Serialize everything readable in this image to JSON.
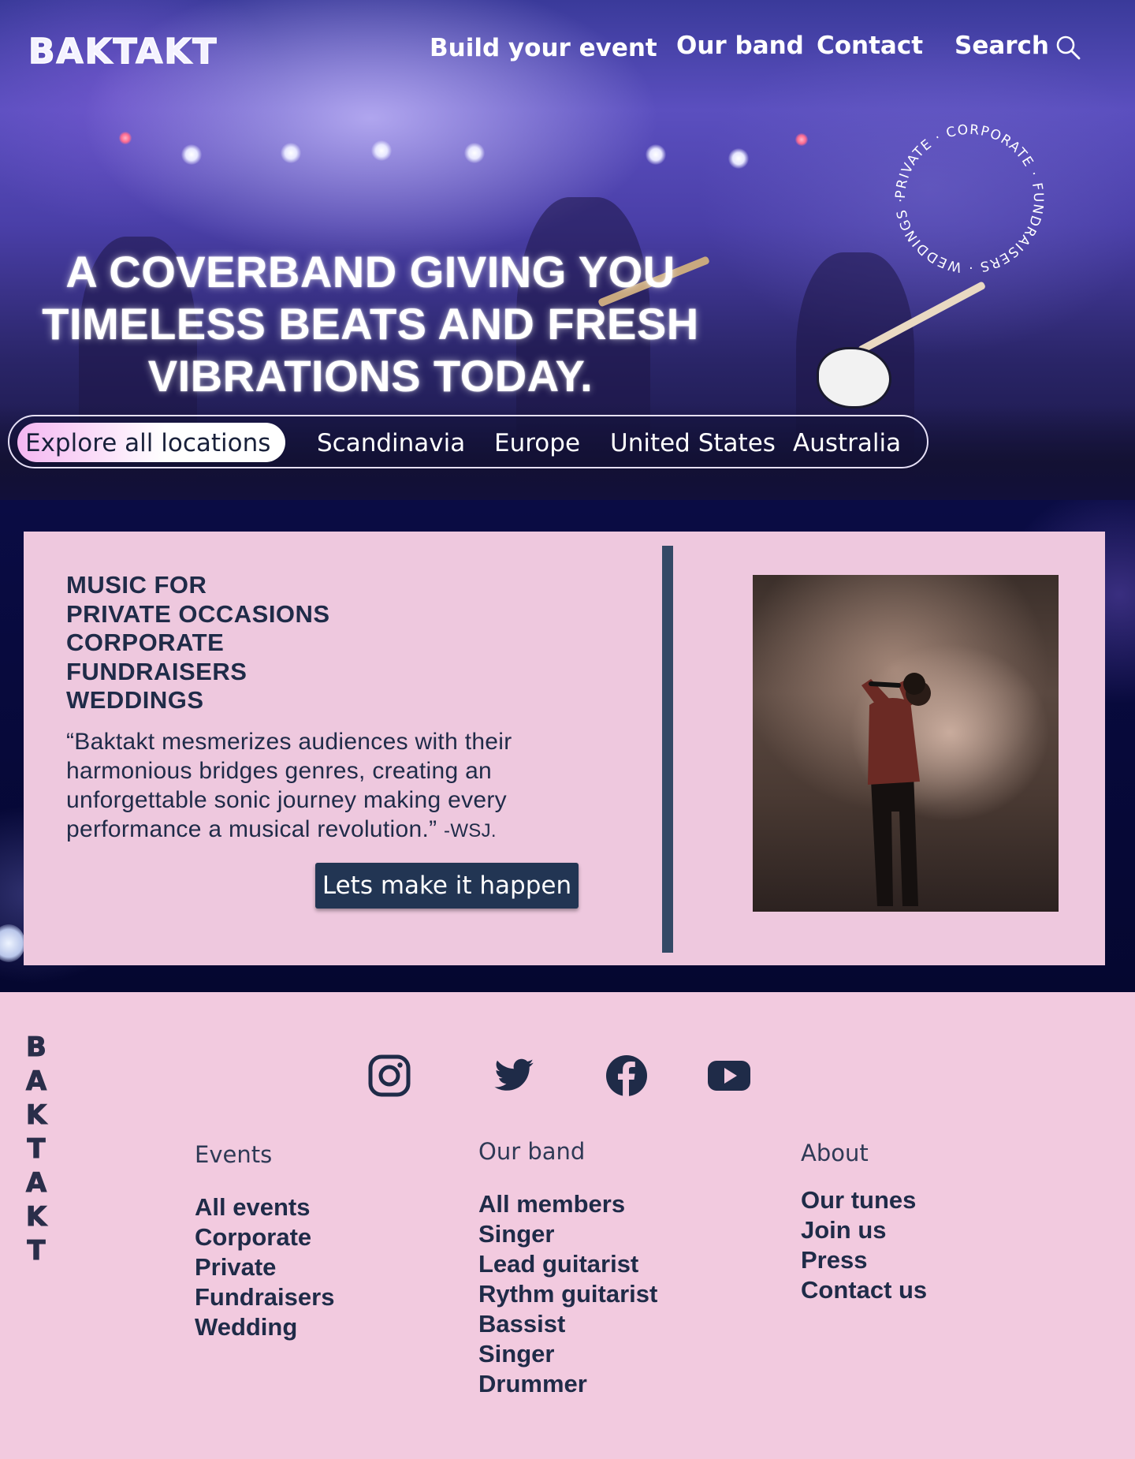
{
  "brand": {
    "logo": "BAKTAKT",
    "vertical_letters": [
      "B",
      "A",
      "K",
      "T",
      "A",
      "K",
      "T"
    ]
  },
  "nav": {
    "build": "Build your event",
    "band": "Our band",
    "contact": "Contact",
    "search": "Search"
  },
  "ring": {
    "text": "PRIVATE · CORPORATE · FUNDRAISERS · WEDDINGS ·"
  },
  "hero": {
    "headline_lines": [
      "A COVERBAND GIVING YOU",
      "TIMELESS BEATS AND FRESH",
      "VIBRATIONS TODAY."
    ]
  },
  "locations": {
    "active": "Explore all locations",
    "items": [
      "Scandinavia",
      "Europe",
      "United States",
      "Australia"
    ]
  },
  "card": {
    "heading_lines": [
      "MUSIC FOR",
      "PRIVATE OCCASIONS",
      "CORPORATE",
      "FUNDRAISERS",
      "WEDDINGS"
    ],
    "quote": "“Baktakt mesmerizes audiences with their harmonious bridges genres, creating an unforgettable sonic journey making every performance a musical revolution.”",
    "quote_source": "-WSJ.",
    "cta": "Lets make it happen"
  },
  "social": [
    "instagram-icon",
    "twitter-icon",
    "facebook-icon",
    "youtube-icon"
  ],
  "footer": {
    "events": {
      "title": "Events",
      "items": [
        "All events",
        "Corporate",
        "Private",
        "Fundraisers",
        "Wedding"
      ]
    },
    "band": {
      "title": "Our band",
      "items": [
        "All members",
        "Singer",
        "Lead guitarist",
        "Rythm guitarist",
        "Bassist",
        "Singer",
        "Drummer"
      ]
    },
    "about": {
      "title": "About",
      "items": [
        "Our tunes",
        "Join us",
        "Press",
        "Contact us"
      ]
    }
  },
  "colors": {
    "footer_bg": "#f2cadf",
    "card_bg": "#eec8de",
    "navy": "#1f2b48",
    "cta_bg": "#223553",
    "divider": "#344966",
    "pill_gradient_start": "#f4b7f1"
  }
}
